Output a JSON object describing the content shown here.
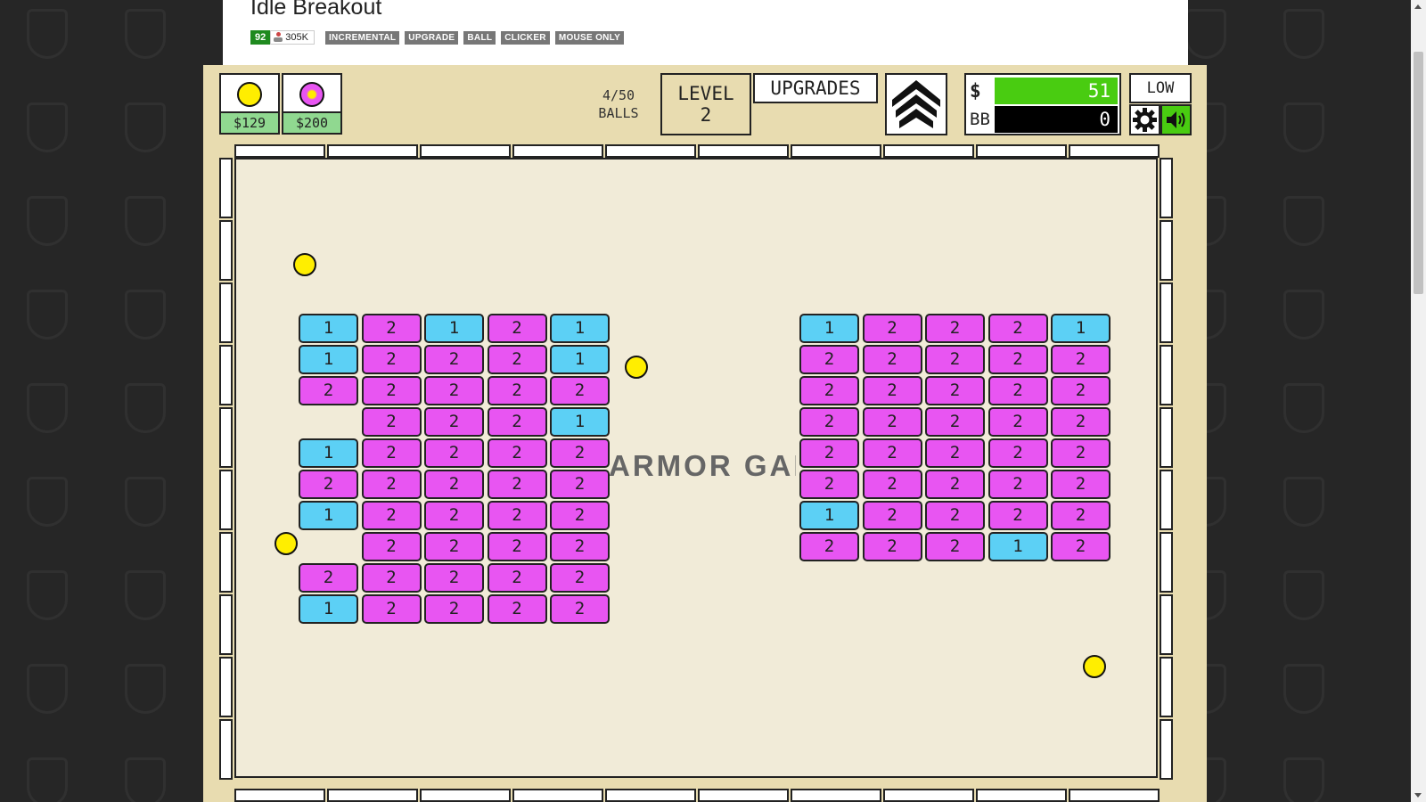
{
  "page": {
    "title": "Idle Breakout",
    "rating": "92",
    "plays": "305K",
    "tags": [
      "INCREMENTAL",
      "UPGRADE",
      "BALL",
      "CLICKER",
      "MOUSE ONLY"
    ]
  },
  "game": {
    "ball_shop": [
      {
        "name": "basic-ball",
        "price": "$129",
        "color": "#ffee00"
      },
      {
        "name": "plasma-ball",
        "price": "$200",
        "color": "#e855f2"
      }
    ],
    "balls_count": "4/50",
    "balls_label": "BALLS",
    "level_label": "LEVEL",
    "level_value": "2",
    "upgrades_label": "UPGRADES",
    "money": {
      "symbol": "$",
      "value": "51"
    },
    "bb": {
      "symbol": "BB",
      "value": "0"
    },
    "quality_label": "LOW",
    "watermark": "ARMOR GAMES",
    "colors": {
      "cyan_brick": "#5cd0f5",
      "magenta_brick": "#e855f2",
      "ball": "#ffee00",
      "money_bar": "#49cc11"
    },
    "brick_groups": [
      {
        "name": "left",
        "rows": [
          [
            "1",
            "2",
            "1",
            "2",
            "1"
          ],
          [
            "1",
            "2",
            "2",
            "2",
            "1"
          ],
          [
            "2",
            "2",
            "2",
            "2",
            "2"
          ],
          [
            "",
            "2",
            "2",
            "2",
            "1"
          ],
          [
            "1",
            "2",
            "2",
            "2",
            "2"
          ],
          [
            "2",
            "2",
            "2",
            "2",
            "2"
          ],
          [
            "1",
            "2",
            "2",
            "2",
            "2"
          ],
          [
            "",
            "2",
            "2",
            "2",
            "2"
          ],
          [
            "2",
            "2",
            "2",
            "2",
            "2"
          ],
          [
            "1",
            "2",
            "2",
            "2",
            "2"
          ]
        ]
      },
      {
        "name": "right",
        "rows": [
          [
            "1",
            "2",
            "2",
            "2",
            "1"
          ],
          [
            "2",
            "2",
            "2",
            "2",
            "2"
          ],
          [
            "2",
            "2",
            "2",
            "2",
            "2"
          ],
          [
            "2",
            "2",
            "2",
            "2",
            "2"
          ],
          [
            "2",
            "2",
            "2",
            "2",
            "2"
          ],
          [
            "2",
            "2",
            "2",
            "2",
            "2"
          ],
          [
            "1",
            "2",
            "2",
            "2",
            "2"
          ],
          [
            "2",
            "2",
            "2",
            "1",
            "2"
          ]
        ]
      }
    ]
  }
}
